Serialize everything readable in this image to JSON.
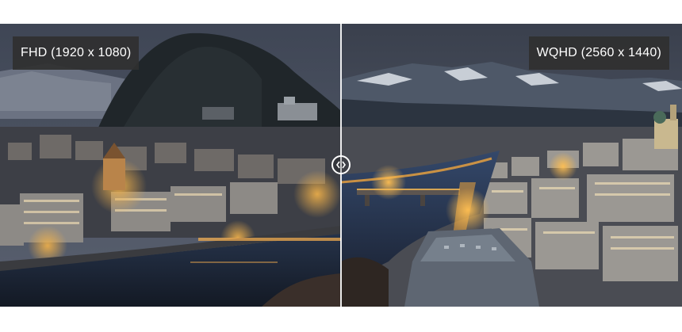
{
  "comparison": {
    "left_label": "FHD (1920 x 1080)",
    "right_label": "WQHD (2560 x 1440)"
  },
  "icons": {
    "handle": "left-right-arrows-icon"
  },
  "colors": {
    "label_bg": "#303030",
    "label_text": "#ffffff",
    "divider": "#ffffff"
  }
}
